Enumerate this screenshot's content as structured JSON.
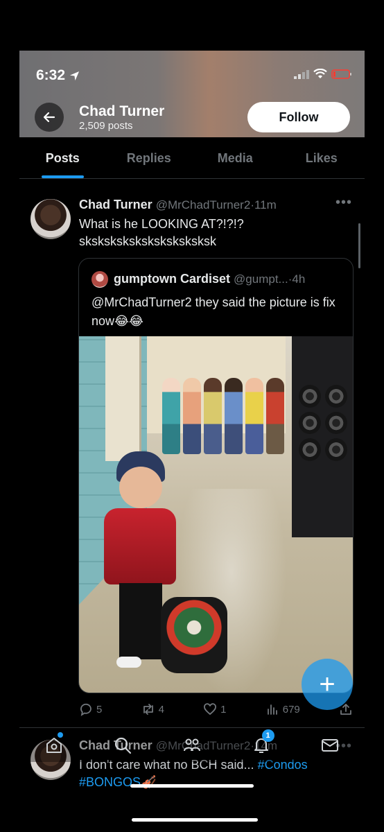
{
  "status_bar": {
    "time": "6:32"
  },
  "header": {
    "name": "Chad Turner",
    "posts_count": "2,509 posts",
    "follow_label": "Follow"
  },
  "tabs": [
    {
      "label": "Posts",
      "active": true
    },
    {
      "label": "Replies",
      "active": false
    },
    {
      "label": "Media",
      "active": false
    },
    {
      "label": "Likes",
      "active": false
    }
  ],
  "post": {
    "name": "Chad Turner",
    "handle": "@MrChadTurner2",
    "time": "11m",
    "text": "What is he LOOKING AT?!?!? sksksksksksksksksksksksk",
    "text_line1": "What is he LOOKING AT?!?!?",
    "text_line2": "sksksksksksksksksksksk",
    "quote": {
      "name": "gumptown Cardiset",
      "handle": "@gumpt...",
      "time": "4h",
      "text": "@MrChadTurner2 they said the picture is fix now😂😂"
    },
    "stats": {
      "replies": "5",
      "reposts": "4",
      "likes": "1",
      "views": "679"
    }
  },
  "post2": {
    "name": "Chad Turner",
    "handle": "@MrChadTurner2",
    "time": "14m",
    "text_prefix": "I don't care what no BCH said...",
    "hashtag1": "#Condos",
    "hashtag2": "#BONGOS",
    "emoji": "🎻"
  },
  "bottom_nav": {
    "notifications_count": "1"
  },
  "colors": {
    "accent": "#1d9bf0",
    "background": "#000000",
    "secondary_text": "#71767b"
  }
}
